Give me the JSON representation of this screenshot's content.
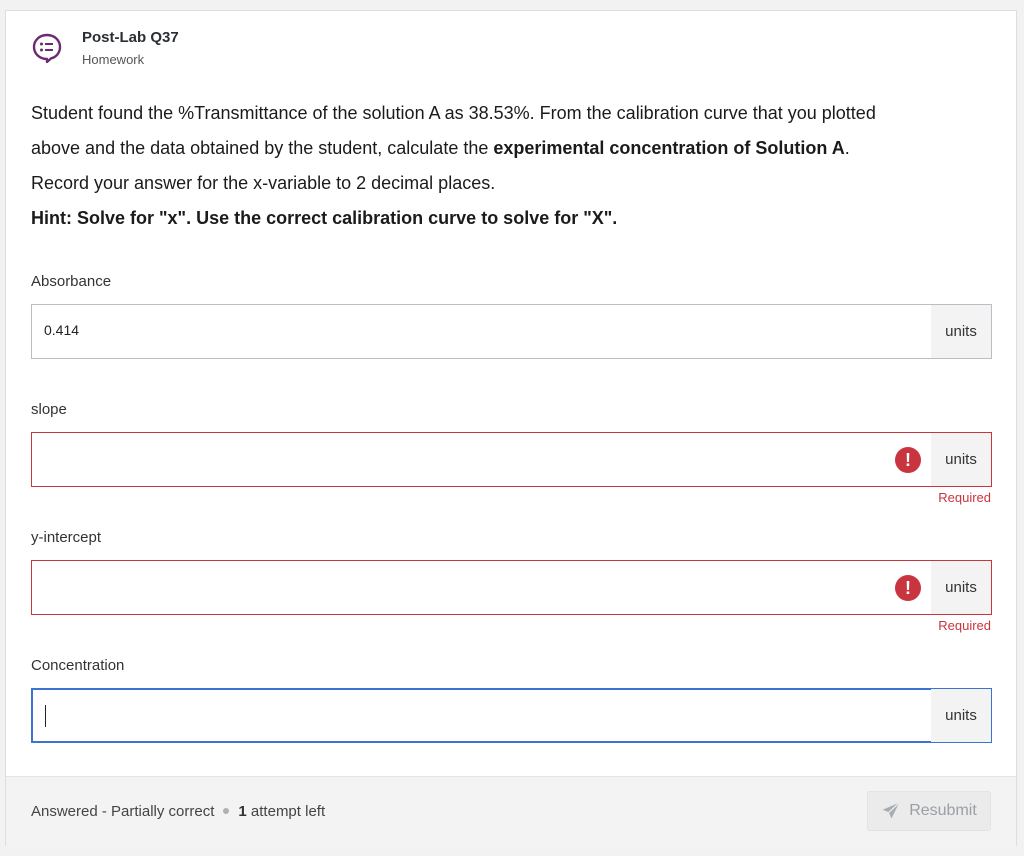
{
  "header": {
    "title": "Post-Lab Q37",
    "subtitle": "Homework"
  },
  "prompt": {
    "line1": "Student found the %Transmittance of the solution A as 38.53%. From the calibration curve that you plotted",
    "line2_prefix": "above and the data obtained by the student, calculate the ",
    "line2_bold": "experimental concentration of Solution A",
    "line2_suffix": ".",
    "line3": "Record your answer for the x-variable to 2 decimal places.",
    "hint": "Hint: Solve for \"x\". Use the correct calibration curve to solve for \"X\"."
  },
  "fields": [
    {
      "label": "Absorbance",
      "value": "0.414",
      "units": "units",
      "state": "filled"
    },
    {
      "label": "slope",
      "value": "",
      "units": "units",
      "state": "error",
      "error_text": "Required"
    },
    {
      "label": "y-intercept",
      "value": "",
      "units": "units",
      "state": "error",
      "error_text": "Required"
    },
    {
      "label": "Concentration",
      "value": "",
      "units": "units",
      "state": "focused"
    }
  ],
  "footer": {
    "status": "Answered - Partially correct",
    "attempts_count": "1",
    "attempts_text": "attempt left",
    "resubmit_label": "Resubmit"
  },
  "colors": {
    "error": "#c9353f",
    "focus": "#3b73d1",
    "icon_purple": "#6b2b73"
  }
}
